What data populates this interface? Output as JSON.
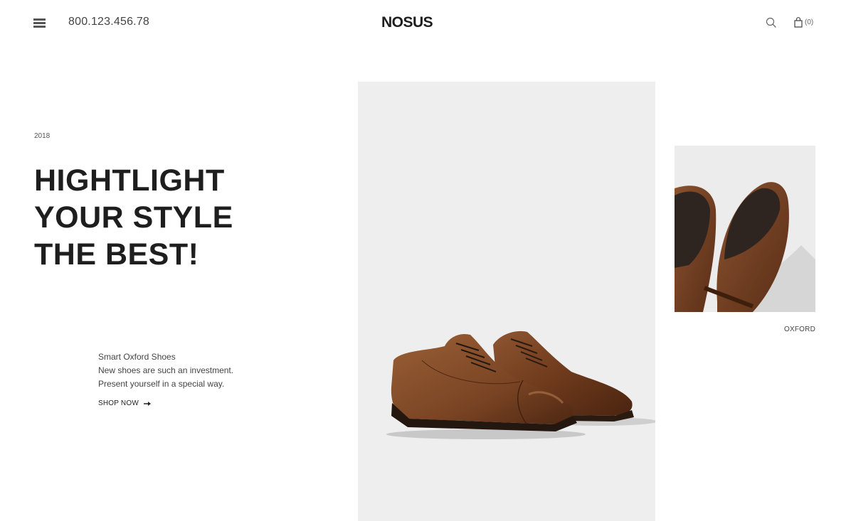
{
  "header": {
    "phone": "800.123.456.78",
    "logo": "NOSUS",
    "cart_count": "(0)",
    "icons": {
      "menu": "hamburger-menu-icon",
      "search": "search-icon",
      "cart": "shopping-bag-icon"
    }
  },
  "hero": {
    "year": "2018",
    "headline": [
      "HIGHTLIGHT",
      "YOUR STYLE",
      "THE BEST!"
    ],
    "description": [
      "Smart Oxford Shoes",
      "New shoes are such an investment.",
      "Present yourself in a special way."
    ],
    "cta_label": "SHOP NOW"
  },
  "products": {
    "side_label": "OXFORD"
  },
  "colors": {
    "text": "#1e1e1e",
    "panel": "#eeeeee",
    "leather": "#7a4424"
  }
}
